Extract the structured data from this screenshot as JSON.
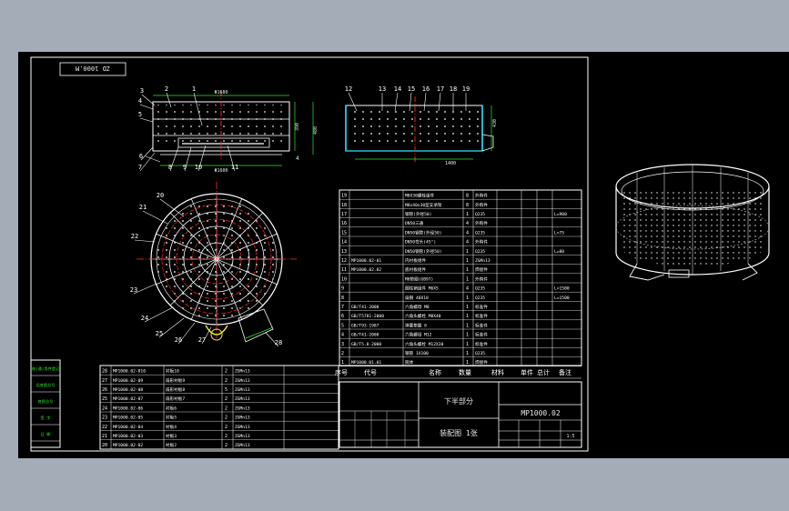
{
  "drawing": {
    "code_stamp": "ZD 1000.M",
    "assembly_code": "MP1000.02",
    "part_title": "下半部分",
    "sheet_info": "装配图  1张",
    "scale_label": "1:5"
  },
  "front_view_balloons": [
    "3",
    "2",
    "1",
    "4",
    "5",
    "6",
    "7",
    "8",
    "9",
    "10",
    "11"
  ],
  "side_view_balloons": [
    "12",
    "13",
    "14",
    "15",
    "16",
    "17",
    "18",
    "19"
  ],
  "plan_view_balloons": [
    "20",
    "21",
    "22",
    "23",
    "24",
    "25",
    "26",
    "27",
    "28"
  ],
  "dimensions": {
    "front_top": "Φ1680",
    "front_bottom": "Φ1600",
    "front_height": "390",
    "front_overall": "480",
    "side_width": "1400",
    "side_height": "430"
  },
  "bom_right": {
    "headers": [
      "序号",
      "代号",
      "名称",
      "数量",
      "材料",
      "单件",
      "总计",
      "备注"
    ],
    "rows": [
      {
        "no": "19",
        "code": "",
        "name": "M8X30螺栓组件",
        "qty": "8",
        "mat": "外购件",
        "note": ""
      },
      {
        "no": "18",
        "code": "",
        "name": "M8x40x30型支承架",
        "qty": "8",
        "mat": "外购件",
        "note": ""
      },
      {
        "no": "17",
        "code": "",
        "name": "钢管(外径50)",
        "qty": "1",
        "mat": "Q235",
        "note": "L=900"
      },
      {
        "no": "16",
        "code": "",
        "name": "DN50三通",
        "qty": "4",
        "mat": "外购件",
        "note": ""
      },
      {
        "no": "15",
        "code": "",
        "name": "DN50钢管(外径50)",
        "qty": "4",
        "mat": "Q235",
        "note": "L=75"
      },
      {
        "no": "14",
        "code": "",
        "name": "DN50弯头(45°)",
        "qty": "4",
        "mat": "外购件",
        "note": ""
      },
      {
        "no": "13",
        "code": "",
        "name": "DN50钢管(外径50)",
        "qty": "1",
        "mat": "Q235",
        "note": "L=80"
      },
      {
        "no": "12",
        "code": "MP1000.02-01",
        "name": "内衬板组件",
        "qty": "1",
        "mat": "ZGMn13",
        "note": ""
      },
      {
        "no": "11",
        "code": "MP1000.02.02",
        "name": "底衬板组件",
        "qty": "1",
        "mat": "焊接件",
        "note": ""
      },
      {
        "no": "10",
        "code": "",
        "name": "M8垫圈(GB97)",
        "qty": "1",
        "mat": "外购件",
        "note": ""
      },
      {
        "no": "9",
        "code": "",
        "name": "圆柱销组件 M6X5",
        "qty": "4",
        "mat": "Q235",
        "note": "L=1500"
      },
      {
        "no": "8",
        "code": "",
        "name": "扁钢 40X10",
        "qty": "1",
        "mat": "Q235",
        "note": "L=1500"
      },
      {
        "no": "7",
        "code": "GB/T41-2000",
        "name": "六角螺母 M8",
        "qty": "1",
        "mat": "标准件",
        "note": ""
      },
      {
        "no": "6",
        "code": "GB/T5781-2000",
        "name": "六角头螺栓 M8X40",
        "qty": "1",
        "mat": "标准件",
        "note": ""
      },
      {
        "no": "5",
        "code": "GB/T93-1987",
        "name": "弹簧垫圈 8",
        "qty": "1",
        "mat": "标准件",
        "note": ""
      },
      {
        "no": "4",
        "code": "GB/T41-2000",
        "name": "六角螺母 M12",
        "qty": "1",
        "mat": "标准件",
        "note": ""
      },
      {
        "no": "3",
        "code": "GB/T5.8-2000",
        "name": "六角头螺栓 M12X30",
        "qty": "1",
        "mat": "标准件",
        "note": ""
      },
      {
        "no": "2",
        "code": "",
        "name": "钢管 1X100",
        "qty": "1",
        "mat": "Q235",
        "note": ""
      },
      {
        "no": "1",
        "code": "MP1000.01.01",
        "name": "筒体",
        "qty": "1",
        "mat": "焊接件",
        "note": ""
      }
    ]
  },
  "bom_left": {
    "rows": [
      {
        "no": "28",
        "code": "MP1000.02-010",
        "name": "衬板10",
        "qty": "2",
        "mat": "ZGMn13"
      },
      {
        "no": "27",
        "code": "MP1000.02-09",
        "name": "扇形衬板9",
        "qty": "2",
        "mat": "ZGMn13"
      },
      {
        "no": "26",
        "code": "MP1000.02-08",
        "name": "扇形衬板8",
        "qty": "5",
        "mat": "ZGMn13"
      },
      {
        "no": "25",
        "code": "MP1000.02-07",
        "name": "扇形衬板7",
        "qty": "2",
        "mat": "ZGMn13"
      },
      {
        "no": "24",
        "code": "MP1000.02-06",
        "name": "衬板6",
        "qty": "2",
        "mat": "ZGMn13"
      },
      {
        "no": "23",
        "code": "MP1000.02-05",
        "name": "衬板5",
        "qty": "2",
        "mat": "ZGMn13"
      },
      {
        "no": "22",
        "code": "MP1000.02-04",
        "name": "衬板4",
        "qty": "2",
        "mat": "ZGMn13"
      },
      {
        "no": "21",
        "code": "MP1000.02-03",
        "name": "衬板3",
        "qty": "2",
        "mat": "ZGMn13"
      },
      {
        "no": "20",
        "code": "MP1000.02-02",
        "name": "衬板2",
        "qty": "2",
        "mat": "ZGMn13"
      }
    ]
  },
  "side_stamp": [
    "借(通)用件登记",
    "旧底图总号",
    "底图总号",
    "签 字",
    "日 期"
  ],
  "colors": {
    "bg": "#a3acb7",
    "sheet": "#000000",
    "line": "#ffffff",
    "red": "#ff2a2a",
    "green": "#2ee82e",
    "cyan": "#34e0ff",
    "yellow": "#f5e93a",
    "magenta": "#ff5cff"
  }
}
